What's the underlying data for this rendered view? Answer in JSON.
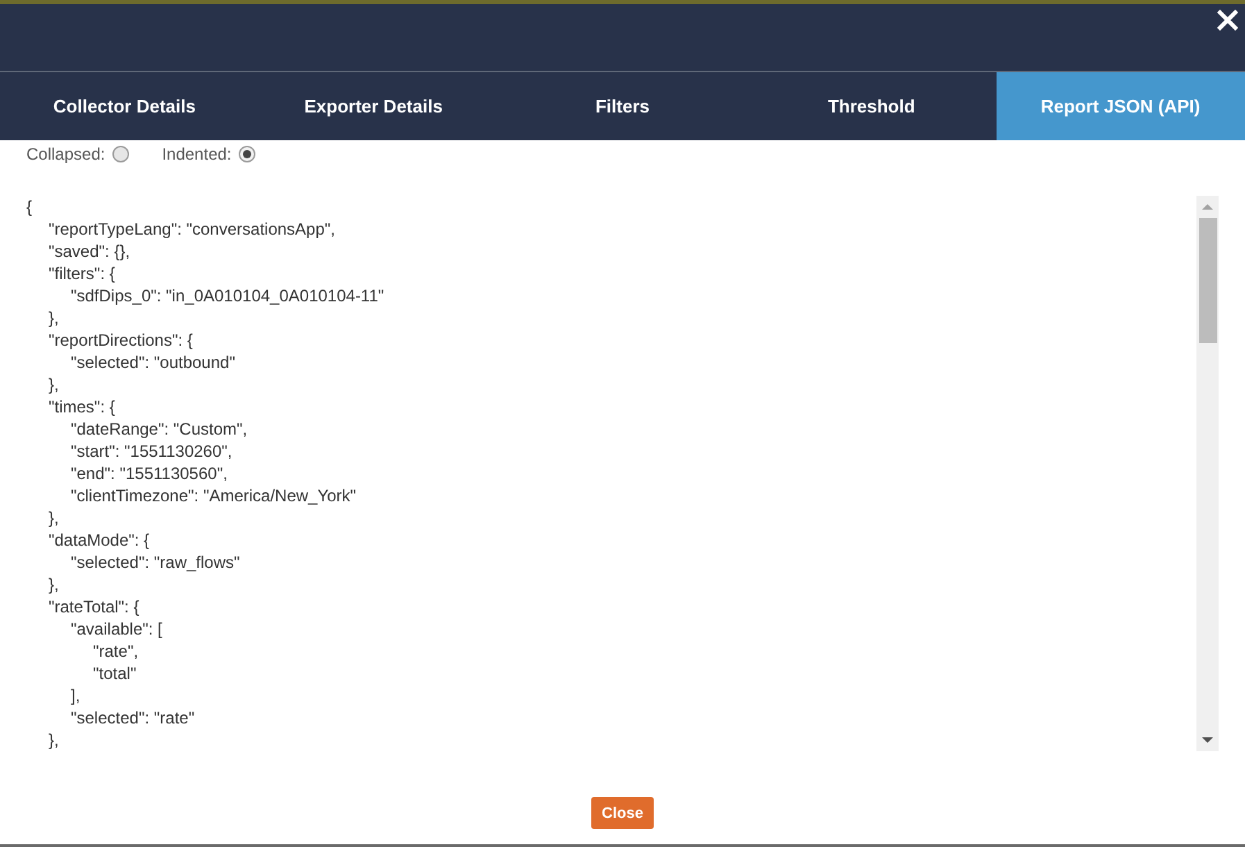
{
  "tabs": [
    {
      "label": "Collector Details",
      "selected": false
    },
    {
      "label": "Exporter Details",
      "selected": false
    },
    {
      "label": "Filters",
      "selected": false
    },
    {
      "label": "Threshold",
      "selected": false
    },
    {
      "label": "Report JSON (API)",
      "selected": true
    }
  ],
  "view_options": [
    {
      "label": "Collapsed:",
      "selected": false
    },
    {
      "label": "Indented:",
      "selected": true
    }
  ],
  "code_lines": [
    {
      "text": "{",
      "children": [
        {
          "text": "\"reportTypeLang\": \"conversationsApp\","
        },
        {
          "text": "\"saved\": {},"
        },
        {
          "text": "\"filters\": {",
          "children": [
            {
              "text": "\"sdfDips_0\": \"in_0A010104_0A010104-11\""
            }
          ]
        },
        {
          "text": "},"
        },
        {
          "text": "\"reportDirections\": {",
          "children": [
            {
              "text": "\"selected\": \"outbound\""
            }
          ]
        },
        {
          "text": "},"
        },
        {
          "text": "\"times\": {",
          "children": [
            {
              "text": "\"dateRange\": \"Custom\","
            },
            {
              "text": "\"start\": \"1551130260\","
            },
            {
              "text": "\"end\": \"1551130560\","
            },
            {
              "text": "\"clientTimezone\": \"America/New_York\""
            }
          ]
        },
        {
          "text": "},"
        },
        {
          "text": "\"dataMode\": {",
          "children": [
            {
              "text": "\"selected\": \"raw_flows\""
            }
          ]
        },
        {
          "text": "},"
        },
        {
          "text": "\"rateTotal\": {",
          "children": [
            {
              "text": "\"available\": [",
              "children": [
                {
                  "text": "\"rate\","
                },
                {
                  "text": "\"total\""
                }
              ]
            },
            {
              "text": "],"
            },
            {
              "text": "\"selected\": \"rate\""
            }
          ]
        },
        {
          "text": "},"
        }
      ]
    }
  ],
  "close_button": {
    "label": "Close"
  }
}
